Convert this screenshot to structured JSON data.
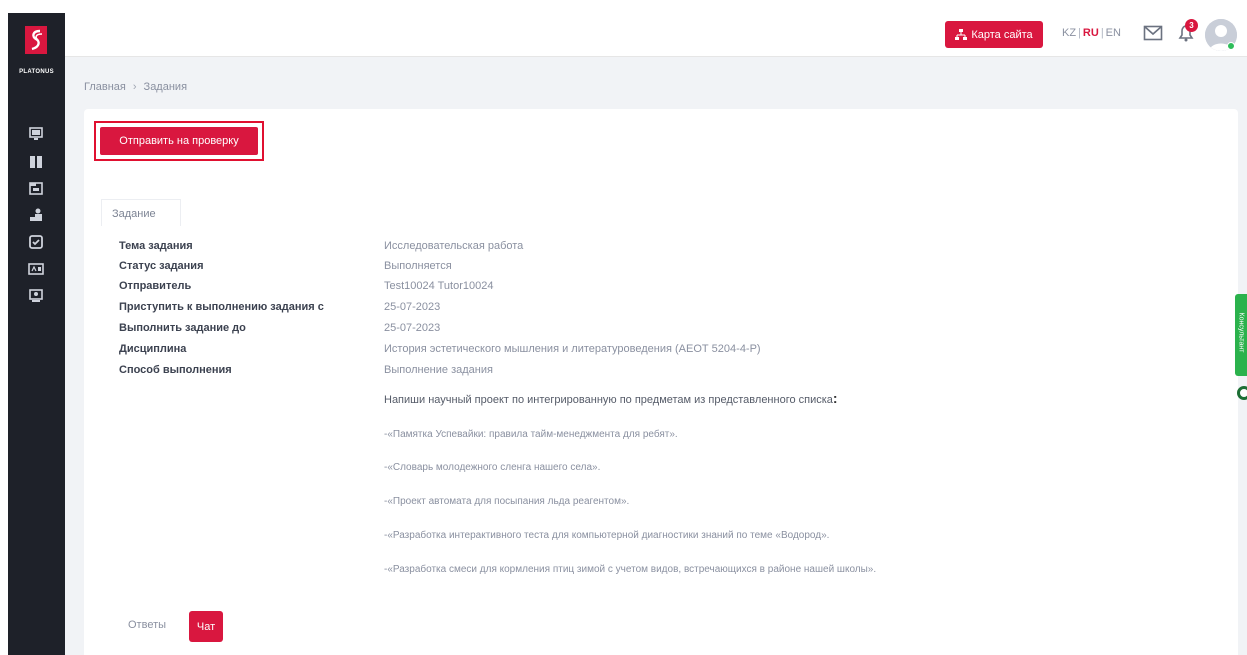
{
  "app": {
    "brand": "PLATONUS"
  },
  "topbar": {
    "sitemap_label": "Карта сайта",
    "languages": [
      "KZ",
      "RU",
      "EN"
    ],
    "active_language": "RU",
    "notification_count": "3"
  },
  "breadcrumb": {
    "home": "Главная",
    "current": "Задания"
  },
  "actions": {
    "submit_label": "Отправить на проверку"
  },
  "tabs": {
    "task": "Задание"
  },
  "details": [
    {
      "label": "Тема задания",
      "value": "Исследовательская работа"
    },
    {
      "label": "Статус задания",
      "value": "Выполняется"
    },
    {
      "label": "Отправитель",
      "value": "Test10024 Tutor10024"
    },
    {
      "label": "Приступить к выполнению задания с",
      "value": "25-07-2023"
    },
    {
      "label": "Выполнить задание до",
      "value": "25-07-2023"
    },
    {
      "label": "Дисциплина",
      "value": "История эстетического мышления и литературоведения (АЕОТ 5204-4-Р)"
    },
    {
      "label": "Способ выполнения",
      "value": "Выполнение задания"
    }
  ],
  "description": {
    "intro": "Напиши научный проект по интегрированную по предметам из представленного списка",
    "colon": ":",
    "items": [
      "-«Памятка Успевайки: правила тайм-менеджмента для ребят».",
      "-«Словарь молодежного сленга нашего села».",
      "-«Проект автомата для посыпания льда реагентом».",
      "-«Разработка интерактивного теста для компьютерной диагностики знаний по теме «Водород».",
      "-«Разработка смеси для кормления птиц зимой с учетом видов, встречающихся в районе нашей школы»."
    ]
  },
  "bottom_tabs": {
    "answers": "Ответы",
    "chat": "Чат"
  },
  "widget": {
    "consultant_label": "Консультант"
  },
  "colors": {
    "accent": "#d9173f",
    "sidebar": "#1e2129",
    "background": "#f1f3f6",
    "consultant": "#2bb24c"
  }
}
